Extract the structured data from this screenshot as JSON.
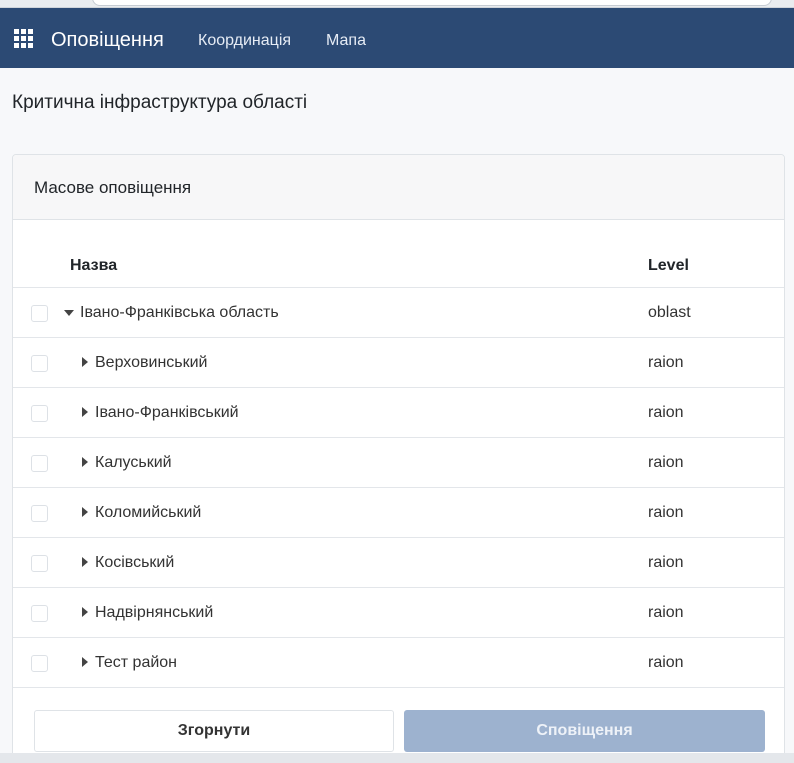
{
  "header": {
    "app_title": "Оповіщення",
    "nav": [
      "Координація",
      "Мапа"
    ],
    "accent_color": "#2c4a74"
  },
  "page": {
    "title": "Критична інфраструктура області"
  },
  "card": {
    "title": "Масове оповіщення",
    "columns": [
      "Назва",
      "Level"
    ],
    "rows": [
      {
        "name": "Івано-Франківська область",
        "level": "oblast",
        "expanded": true,
        "checked": false
      },
      {
        "name": "Верховинський",
        "level": "raion",
        "expanded": false,
        "checked": false
      },
      {
        "name": "Івано-Франківський",
        "level": "raion",
        "expanded": false,
        "checked": false
      },
      {
        "name": "Калуський",
        "level": "raion",
        "expanded": false,
        "checked": false
      },
      {
        "name": "Коломийський",
        "level": "raion",
        "expanded": false,
        "checked": false
      },
      {
        "name": "Косівський",
        "level": "raion",
        "expanded": false,
        "checked": false
      },
      {
        "name": "Надвірнянський",
        "level": "raion",
        "expanded": false,
        "checked": false
      },
      {
        "name": "Тест район",
        "level": "raion",
        "expanded": false,
        "checked": false
      }
    ],
    "buttons": {
      "collapse": "Згорнути",
      "notify": "Сповіщення"
    }
  },
  "icons": {
    "apps": "grid-icon",
    "expanded": "caret-down-icon",
    "collapsed": "caret-right-icon"
  }
}
